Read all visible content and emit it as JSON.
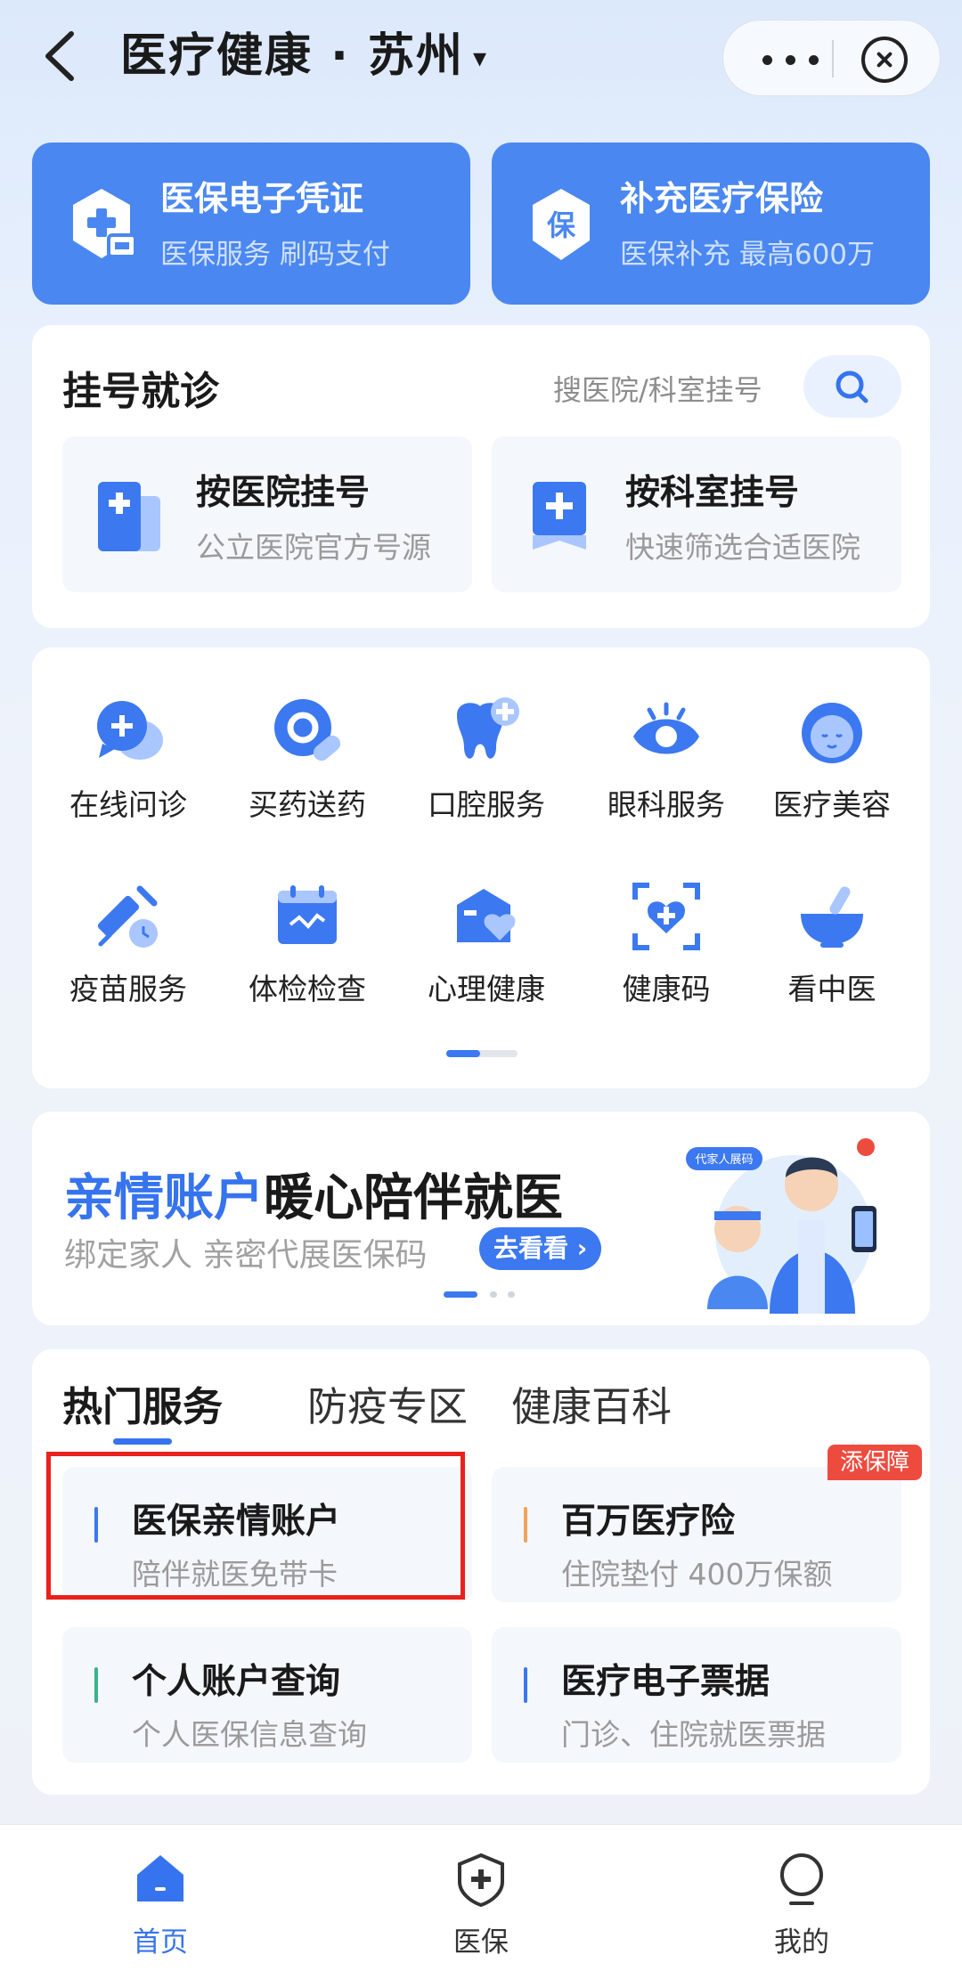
{
  "header": {
    "title": "医疗健康 · 苏州",
    "caret": "▾"
  },
  "promos": [
    {
      "title": "医保电子凭证",
      "subtitle": "医保服务 刷码支付",
      "icon": "medical-card-icon"
    },
    {
      "title": "补充医疗保险",
      "subtitle": "医保补充 最高600万",
      "icon": "insurance-shield-icon",
      "icon_text": "保"
    }
  ],
  "registration": {
    "title": "挂号就诊",
    "search_placeholder": "搜医院/科室挂号",
    "items": [
      {
        "title": "按医院挂号",
        "subtitle": "公立医院官方号源",
        "icon": "hospital-icon"
      },
      {
        "title": "按科室挂号",
        "subtitle": "快速筛选合适医院",
        "icon": "department-icon"
      }
    ]
  },
  "services": [
    {
      "label": "在线问诊",
      "icon": "chat-consult-icon"
    },
    {
      "label": "买药送药",
      "icon": "medicine-icon"
    },
    {
      "label": "口腔服务",
      "icon": "tooth-icon"
    },
    {
      "label": "眼科服务",
      "icon": "eye-icon"
    },
    {
      "label": "医疗美容",
      "icon": "face-icon"
    },
    {
      "label": "疫苗服务",
      "icon": "vaccine-icon"
    },
    {
      "label": "体检检查",
      "icon": "calendar-checkup-icon"
    },
    {
      "label": "心理健康",
      "icon": "heart-box-icon"
    },
    {
      "label": "健康码",
      "icon": "health-code-icon"
    },
    {
      "label": "看中医",
      "icon": "mortar-icon"
    }
  ],
  "banner": {
    "title_highlight": "亲情账户",
    "title_rest": "暖心陪伴就医",
    "subtitle": "绑定家人 亲密代展医保码",
    "button": "去看看",
    "art_tag": "代家人展码"
  },
  "hot": {
    "tabs": [
      "热门服务",
      "防疫专区",
      "健康百科"
    ],
    "badge": "添保障",
    "items": [
      {
        "title": "医保亲情账户",
        "subtitle": "陪伴就医免带卡",
        "bar_color": "#3c78f0"
      },
      {
        "title": "百万医疗险",
        "subtitle": "住院垫付 400万保额",
        "bar_color": "#f0a35a"
      },
      {
        "title": "个人账户查询",
        "subtitle": "个人医保信息查询",
        "bar_color": "#3bb38a"
      },
      {
        "title": "医疗电子票据",
        "subtitle": "门诊、住院就医票据",
        "bar_color": "#3c78f0"
      }
    ]
  },
  "tabbar": [
    {
      "label": "首页",
      "icon": "home-icon",
      "active": true
    },
    {
      "label": "医保",
      "icon": "shield-plus-icon",
      "active": false
    },
    {
      "label": "我的",
      "icon": "profile-icon",
      "active": false
    }
  ],
  "colors": {
    "accent": "#3674ef",
    "promo_bg": "#4a87f0",
    "highlight_border": "#e8211d",
    "badge": "#ee4b3f"
  }
}
